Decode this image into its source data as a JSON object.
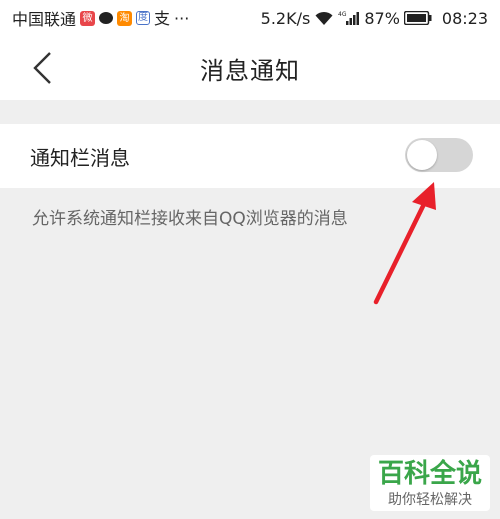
{
  "status_bar": {
    "carrier": "中国联通",
    "app_icons": [
      "weibo-icon",
      "chat-icon",
      "taobao-icon",
      "baidu-icon",
      "alipay-icon"
    ],
    "more": "···",
    "net_speed": "5.2K/s",
    "network": "4G",
    "battery": "87%",
    "time": "08:23"
  },
  "header": {
    "title": "消息通知",
    "back_icon": "chevron-left-icon"
  },
  "settings": {
    "notification_bar": {
      "label": "通知栏消息",
      "enabled": false,
      "description": "允许系统通知栏接收来自QQ浏览器的消息"
    }
  },
  "annotation": {
    "arrow_color": "#e8202a",
    "points_to": "notification-toggle"
  },
  "watermark": {
    "main": "百科全说",
    "sub": "助你轻松解决"
  },
  "colors": {
    "background": "#efefef",
    "surface": "#ffffff",
    "toggle_off": "#d6d6d6",
    "watermark_green": "#3aa64a"
  }
}
